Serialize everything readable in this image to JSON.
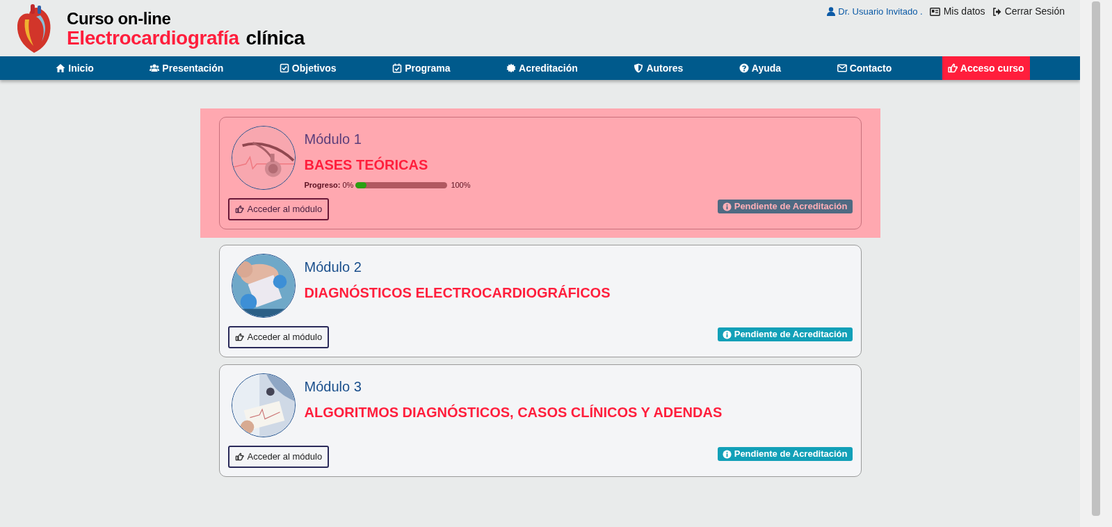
{
  "header": {
    "logo_line_1": "Curso on-line",
    "logo_line_2_accent": "Electrocardiografía",
    "logo_line_2_rest": "clínica"
  },
  "user_bar": {
    "user": "Dr. Usuario Invitado .",
    "links": [
      "Mis datos",
      "Cerrar Sesión"
    ]
  },
  "nav": [
    {
      "label": "Inicio",
      "selected": false
    },
    {
      "label": "Presentación",
      "selected": false
    },
    {
      "label": "Objetivos",
      "selected": false
    },
    {
      "label": "Programa",
      "selected": false
    },
    {
      "label": "Acreditación",
      "selected": false
    },
    {
      "label": "Autores",
      "selected": false
    },
    {
      "label": "Ayuda",
      "selected": false
    },
    {
      "label": "Contacto",
      "selected": false
    },
    {
      "label": "Acceso curso",
      "selected": true
    }
  ],
  "modules": [
    {
      "number": "Módulo 1",
      "title": "BASES TEÓRICAS",
      "highlighted": true,
      "progress": {
        "label": "Progreso:",
        "start": "0%",
        "end": "100%",
        "level": 0.12
      },
      "button": "Acceder al módulo",
      "badge": "Pendiente de Acreditación"
    },
    {
      "number": "Módulo 2",
      "title": "DIAGNÓSTICOS ELECTROCARDIOGRÁFICOS",
      "highlighted": false,
      "button": "Acceder al módulo",
      "badge": "Pendiente de Acreditación"
    },
    {
      "number": "Módulo 3",
      "title": "ALGORITMOS DIAGNÓSTICOS, CASOS CLÍNICOS Y ADENDAS",
      "highlighted": false,
      "button": "Acceder al módulo",
      "badge": "Pendiente de Acreditación"
    }
  ]
}
